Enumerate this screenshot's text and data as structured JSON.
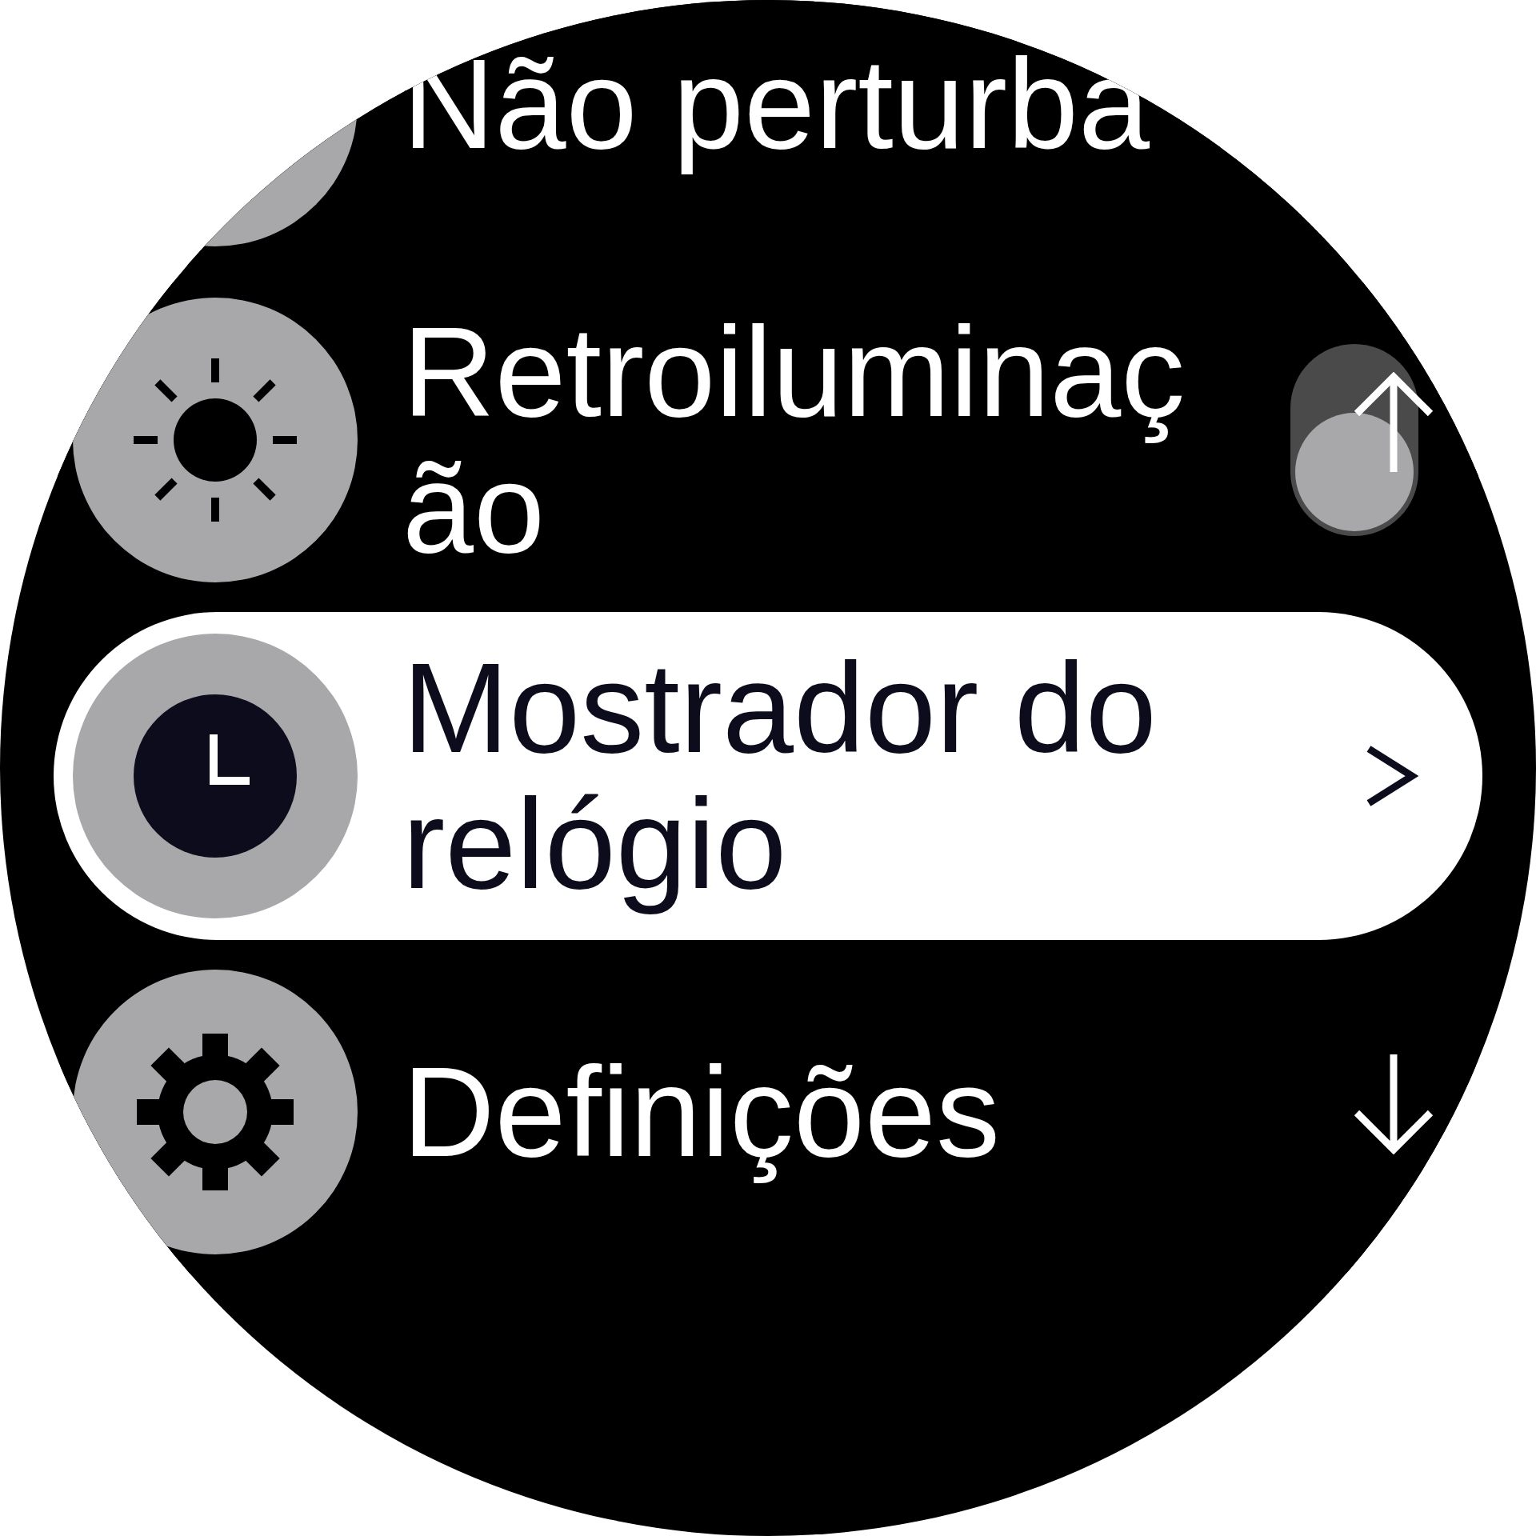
{
  "menu": {
    "items": [
      {
        "label": "Não perturba",
        "kind": "plain",
        "selected": false
      },
      {
        "label": "Retroiluminação",
        "kind": "toggle",
        "on": false,
        "selected": false
      },
      {
        "label": "Mostrador do relógio",
        "kind": "link",
        "selected": true
      },
      {
        "label": "Definições",
        "kind": "plain",
        "selected": false
      }
    ]
  }
}
